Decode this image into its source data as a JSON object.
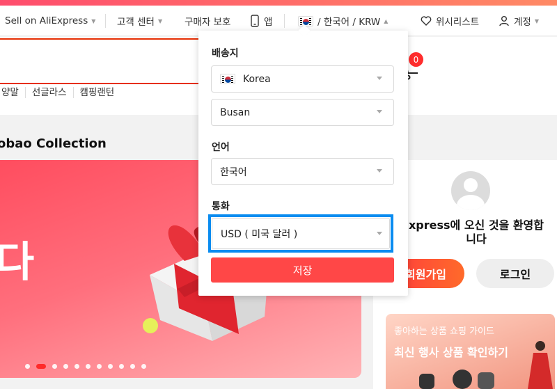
{
  "topbar": {
    "sell_label": "Sell on AliExpress",
    "customer_center_label": "고객 센터",
    "buyer_protection_label": "구매자 보호",
    "app_label": "앱",
    "locale_label": "/ 한국어 /  KRW",
    "wishlist_label": "위시리스트",
    "account_label": "계정"
  },
  "search": {
    "cart_count": "0",
    "quick_links": [
      "양말",
      "선글라스",
      "캠핑랜턴"
    ]
  },
  "section": {
    "title": "obao Collection"
  },
  "banner": {
    "text": "다",
    "slide_count": 11,
    "active_slide": 2
  },
  "account_panel": {
    "welcome": "xpress에 오신 것을 환영합\n니다",
    "signup_label": "회원가입",
    "login_label": "로그인"
  },
  "promo": {
    "small_text": "좋아하는 상품 쇼핑 가이드",
    "big_text": "최신 행사 상품 확인하기"
  },
  "settings_dropdown": {
    "ship_to_label": "배송지",
    "country_value": "Korea",
    "city_value": "Busan",
    "language_label": "언어",
    "language_value": "한국어",
    "currency_label": "통화",
    "currency_value": "USD ( 미국 달러 )",
    "save_label": "저장"
  },
  "colors": {
    "accent_red": "#ff4747",
    "focus_blue": "#0a8cf0",
    "search_border": "#e62e04"
  }
}
